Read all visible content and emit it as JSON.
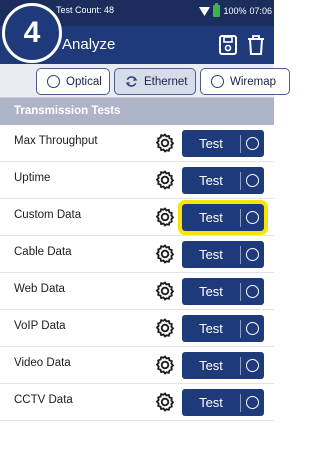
{
  "badge": "4",
  "status": {
    "test_count": "Test Count: 48",
    "battery": "100%",
    "time": "07:06"
  },
  "appbar": {
    "back_glyph": "‹",
    "title": "Analyze",
    "icons": [
      "save-icon",
      "trash-icon"
    ]
  },
  "tabs": [
    {
      "label": "Optical",
      "icon": "radio-icon",
      "active": false
    },
    {
      "label": "Ethernet",
      "icon": "refresh-icon",
      "active": true
    },
    {
      "label": "Wiremap",
      "icon": "radio-icon",
      "active": false
    }
  ],
  "section_title": "Transmission Tests",
  "test_button_label": "Test",
  "rows": [
    {
      "label": "Max Throughput",
      "highlighted": false
    },
    {
      "label": "Uptime",
      "highlighted": false
    },
    {
      "label": "Custom Data",
      "highlighted": true
    },
    {
      "label": "Cable Data",
      "highlighted": false
    },
    {
      "label": "Web Data",
      "highlighted": false
    },
    {
      "label": "VoIP Data",
      "highlighted": false
    },
    {
      "label": "Video Data",
      "highlighted": false
    },
    {
      "label": "CCTV Data",
      "highlighted": false
    }
  ],
  "colors": {
    "header": "#1f3a7a",
    "statusbar": "#1a2d5c",
    "section": "#aeb4c7",
    "highlight": "#f6e500",
    "battery": "#39b54a"
  }
}
